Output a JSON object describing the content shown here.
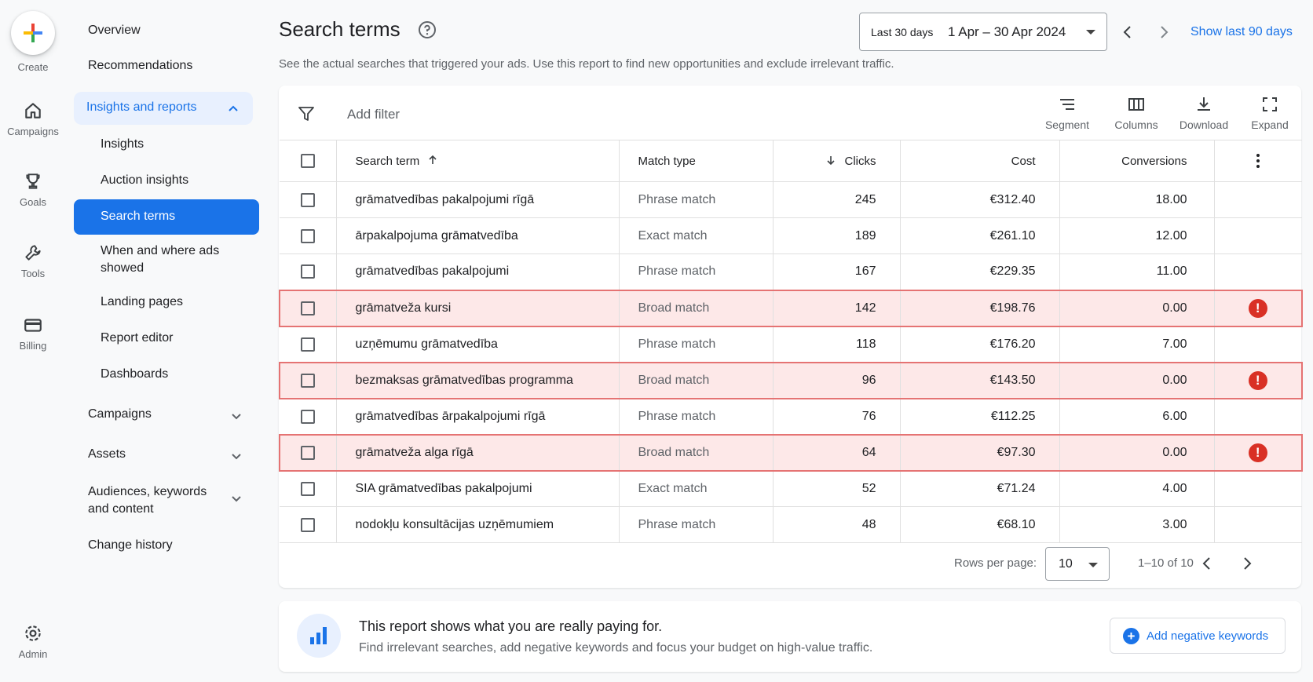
{
  "rail": {
    "create": "Create",
    "campaigns": "Campaigns",
    "goals": "Goals",
    "tools": "Tools",
    "billing": "Billing",
    "admin": "Admin"
  },
  "nav": {
    "overview": "Overview",
    "recommendations": "Recommendations",
    "insights_reports": "Insights and reports",
    "insights": "Insights",
    "auction_insights": "Auction insights",
    "search_terms": "Search terms",
    "when_where_1": "When and where ads",
    "when_where_2": "showed",
    "landing_pages": "Landing pages",
    "report_editor": "Report editor",
    "dashboards": "Dashboards",
    "campaigns": "Campaigns",
    "assets": "Assets",
    "audiences_1": "Audiences, keywords",
    "audiences_2": "and content",
    "change_history": "Change history"
  },
  "header": {
    "title": "Search terms",
    "subtitle": "See the actual searches that triggered your ads. Use this report to find new opportunities and exclude irrelevant traffic.",
    "date_label": "Last 30 days",
    "date_range": "1 Apr – 30 Apr 2024",
    "show_last": "Show last 90 days"
  },
  "toolbar": {
    "add_filter": "Add filter",
    "segment": "Segment",
    "columns": "Columns",
    "download": "Download",
    "expand": "Expand"
  },
  "table": {
    "columns": {
      "term": "Search term",
      "match": "Match type",
      "clicks": "Clicks",
      "cost": "Cost",
      "conversions": "Conversions"
    },
    "rows": [
      {
        "term": "grāmatvedības pakalpojumi rīgā",
        "match": "Phrase match",
        "clicks": "245",
        "cost": "€312.40",
        "conv": "18.00",
        "flag": false
      },
      {
        "term": "ārpakalpojuma grāmatvedība",
        "match": "Exact match",
        "clicks": "189",
        "cost": "€261.10",
        "conv": "12.00",
        "flag": false
      },
      {
        "term": "grāmatvedības pakalpojumi",
        "match": "Phrase match",
        "clicks": "167",
        "cost": "€229.35",
        "conv": "11.00",
        "flag": false
      },
      {
        "term": "grāmatveža kursi",
        "match": "Broad match",
        "clicks": "142",
        "cost": "€198.76",
        "conv": "0.00",
        "flag": true
      },
      {
        "term": "uzņēmumu grāmatvedība",
        "match": "Phrase match",
        "clicks": "118",
        "cost": "€176.20",
        "conv": "7.00",
        "flag": false
      },
      {
        "term": "bezmaksas grāmatvedības programma",
        "match": "Broad match",
        "clicks": "96",
        "cost": "€143.50",
        "conv": "0.00",
        "flag": true
      },
      {
        "term": "grāmatvedības ārpakalpojumi rīgā",
        "match": "Phrase match",
        "clicks": "76",
        "cost": "€112.25",
        "conv": "6.00",
        "flag": false
      },
      {
        "term": "grāmatveža alga rīgā",
        "match": "Broad match",
        "clicks": "64",
        "cost": "€97.30",
        "conv": "0.00",
        "flag": true
      },
      {
        "term": "SIA grāmatvedības pakalpojumi",
        "match": "Exact match",
        "clicks": "52",
        "cost": "€71.24",
        "conv": "4.00",
        "flag": false
      },
      {
        "term": "nodokļu konsultācijas uzņēmumiem",
        "match": "Phrase match",
        "clicks": "48",
        "cost": "€68.10",
        "conv": "3.00",
        "flag": false
      }
    ],
    "warn_glyph": "!"
  },
  "pagination": {
    "rows_label": "Rows per page:",
    "rows_value": "10",
    "range": "1–10 of 10"
  },
  "banner": {
    "title": "This report shows what you are really paying for.",
    "subtitle": "Find irrelevant searches, add negative keywords and focus your budget on high-value traffic.",
    "button": "Add negative keywords",
    "plus_glyph": "+"
  },
  "colors": {
    "accent": "#1a73e8",
    "warning": "#d93025",
    "flag_bg": "#fde8e8"
  }
}
